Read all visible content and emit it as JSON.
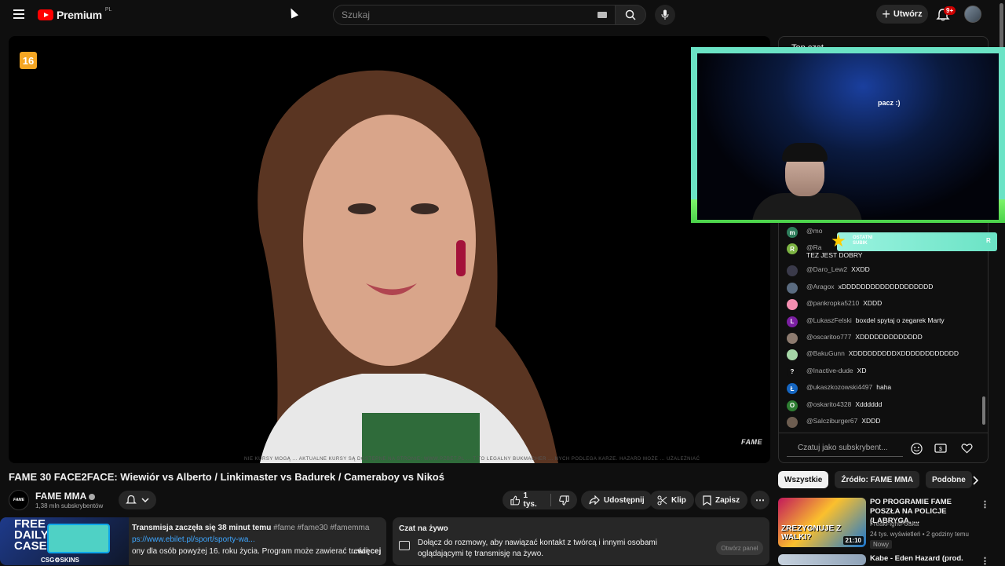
{
  "topbar": {
    "logo_text": "Premium",
    "logo_region": "PL",
    "search_placeholder": "Szukaj",
    "create_label": "Utwórz",
    "notifications_badge": "9+"
  },
  "video": {
    "age_rating": "16",
    "watermark": "FAME",
    "disclaimer": "NIE KURSY MOGĄ ... AKTUALNE KURSY SĄ DOSTĘPNE NA STRONIE: WWW.PZBET.PL ... T TO LEGALNY BUKMACHER ... NYCH PODLEGA KARZE. HAZARD MOŻE ... UŻALEŻNIAĆ",
    "title": "FAME 30 FACE2FACE: Wiewiór vs Alberto / Linkimaster vs Badurek / Cameraboy vs Nikoś"
  },
  "channel": {
    "name": "FAME MMA",
    "subscribers": "1,38 mln subskrybentów",
    "avatar_text": "FAME"
  },
  "actions": {
    "likes": "1 tys.",
    "share": "Udostępnij",
    "clip": "Klip",
    "save": "Zapisz"
  },
  "description": {
    "ad_top": "FREE",
    "ad_mid": "DAILY",
    "ad_bot": "CASE",
    "ad_brand": "CSG⚙SKINS",
    "started": "Transmisja zaczęła się 38 minut temu",
    "tags": "#fame #fame30 #famemma",
    "link": "ps://www.ebilet.pl/sport/sporty-wa...",
    "body": "ony dla osób powyżej 16. roku życia. Program może zawierać treści",
    "more": "...więcej"
  },
  "live_chat_card": {
    "header": "Czat na żywo",
    "text": "Dołącz do rozmowy, aby nawiązać kontakt z twórcą i innymi osobami oglądającymi tę transmisję na żywo.",
    "open_button": "Otwórz panel"
  },
  "chat": {
    "header": "Top czat",
    "input_placeholder": "Czatuj jako subskrybent...",
    "messages": [
      {
        "initial": "m",
        "color": "#2e7d5b",
        "author": "@mo",
        "text": ""
      },
      {
        "initial": "R",
        "color": "#7cb342",
        "author": "@Ra",
        "text": "TEZ JEST DOBRY"
      },
      {
        "initial": "",
        "color": "#3a3a4a",
        "author": "@Daro_Lew2",
        "text": "XXDD"
      },
      {
        "initial": "",
        "color": "#5a6b80",
        "author": "@Aragox",
        "text": "xDDDDDDDDDDDDDDDDDDD"
      },
      {
        "initial": "",
        "color": "#f48fb1",
        "author": "@pankropka5210",
        "text": "XDDD"
      },
      {
        "initial": "L",
        "color": "#7b1fa2",
        "author": "@LukaszFelski",
        "text": "boxdel spytaj o zegarek Marty"
      },
      {
        "initial": "",
        "color": "#8d7b6f",
        "author": "@oscaritoo777",
        "text": "XDDDDDDDDDDDDD"
      },
      {
        "initial": "",
        "color": "#a5d6a7",
        "author": "@BakuGunn",
        "text": "XDDDDDDDDDXDDDDDDDDDDDD"
      },
      {
        "initial": "?",
        "color": "#0f0f0f",
        "author": "@Inactive-dude",
        "text": "XD"
      },
      {
        "initial": "Ł",
        "color": "#1565c0",
        "author": "@ukaszkozowski4497",
        "text": "haha"
      },
      {
        "initial": "O",
        "color": "#2e7d32",
        "author": "@oskarito4328",
        "text": "Xdddddd"
      },
      {
        "initial": "",
        "color": "#6d5d50",
        "author": "@Salcziburger67",
        "text": "XDDD"
      }
    ]
  },
  "stream_overlay": {
    "cam_subtitle": "pacz :)",
    "alert_line1": "OSTATNI",
    "alert_line2": "SUBIK",
    "alert_name": "R"
  },
  "filters": {
    "chips": [
      "Wszystkie",
      "Źródło: FAME MMA",
      "Podobne"
    ]
  },
  "related": [
    {
      "title": "PO PROGRAMIE FAME POSZŁA NA POLICJE (LABRYGA, ...",
      "channel": "FreakFightPolska",
      "meta": "24 tys. wyświetleń • 2 godziny temu",
      "badge": "Nowy",
      "duration": "21:10",
      "thumb_text": "ZREZYGNUJE Z WALKI?"
    },
    {
      "title": "Kabe - Eden Hazard (prod.",
      "channel": "",
      "meta": "",
      "badge": "",
      "duration": "",
      "thumb_text": ""
    }
  ]
}
